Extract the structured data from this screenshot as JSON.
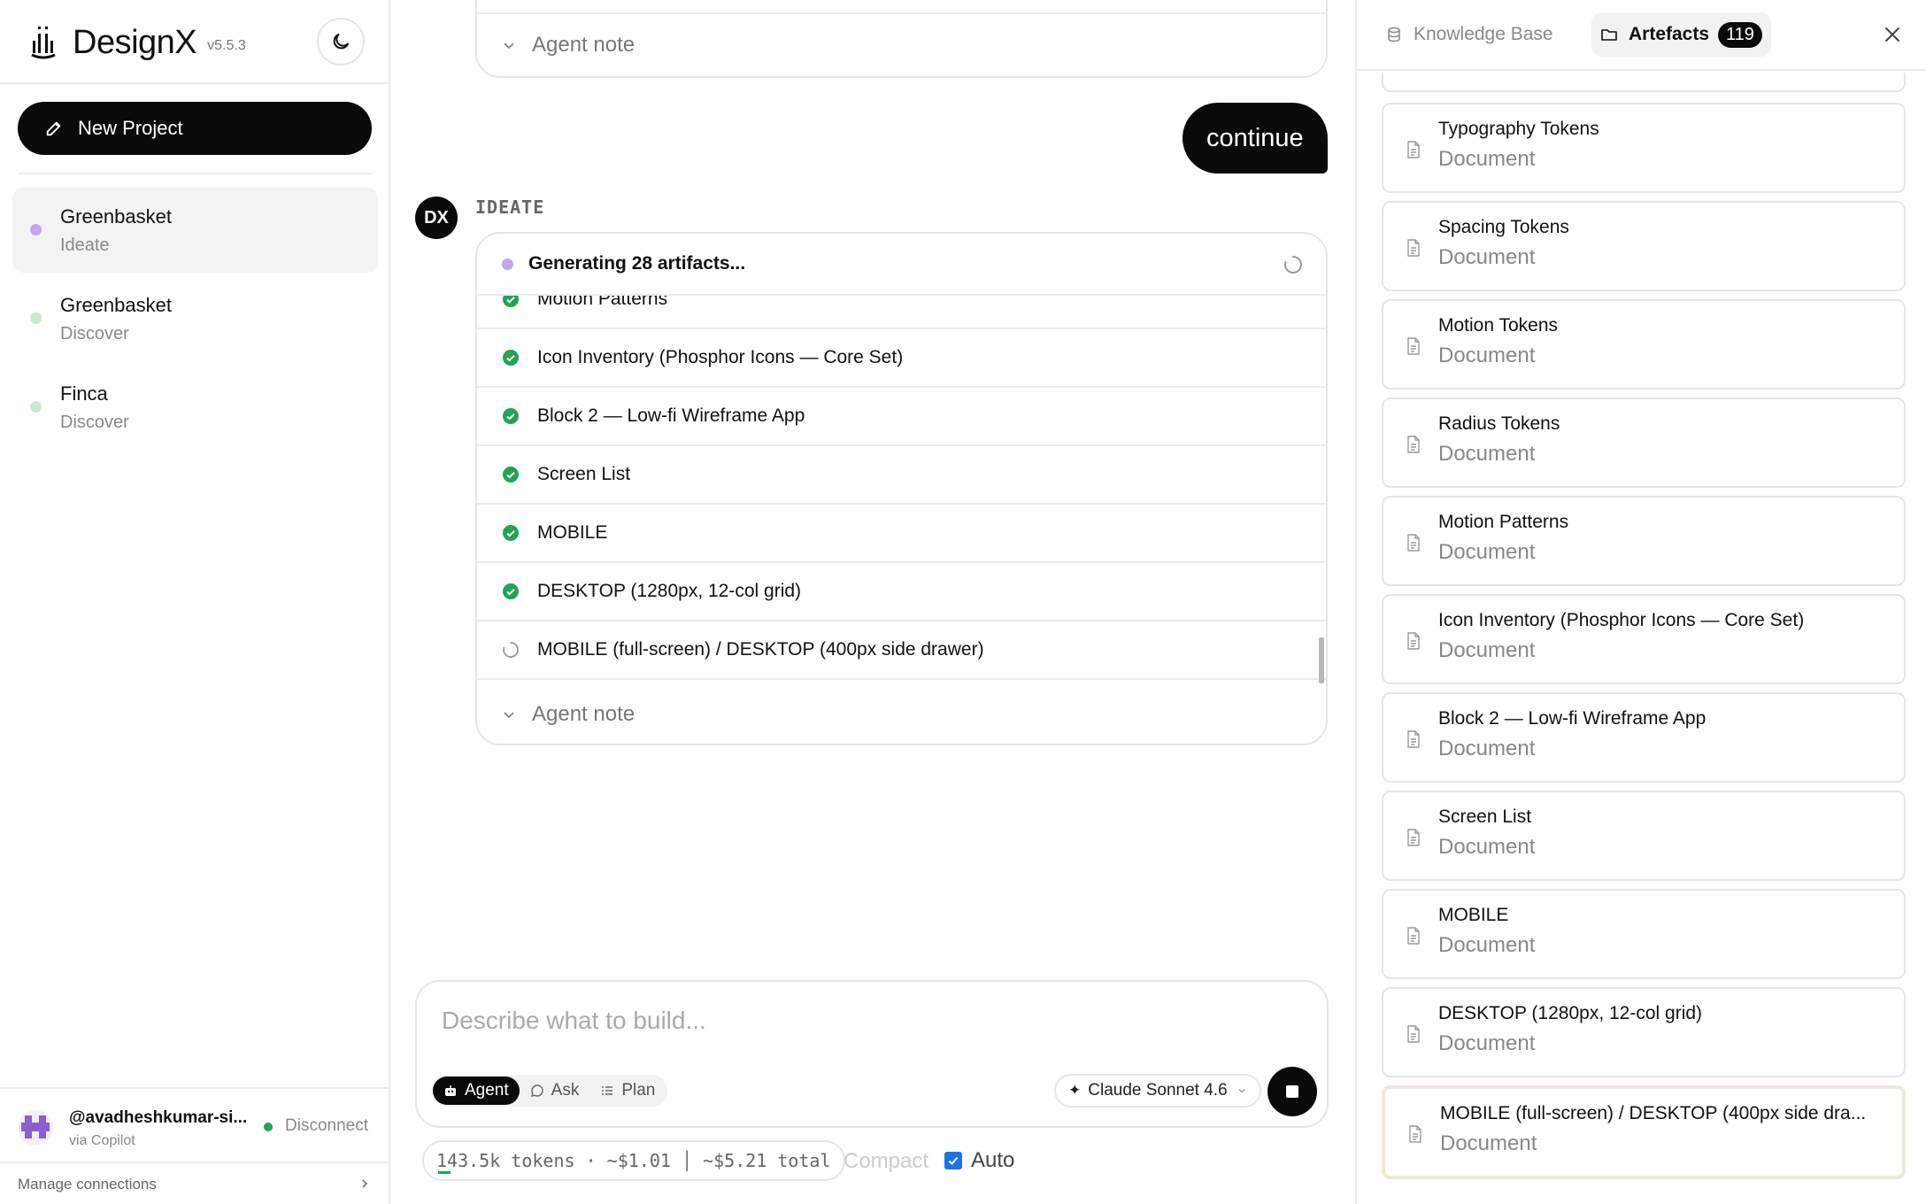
{
  "sidebar": {
    "brand": {
      "name": "DesignX",
      "version": "v5.5.3"
    },
    "new_project_label": "New Project",
    "projects": [
      {
        "name": "Greenbasket",
        "phase": "Ideate",
        "dot_color": "#c4a9ec",
        "active": true
      },
      {
        "name": "Greenbasket",
        "phase": "Discover",
        "dot_color": "#c9e8d2",
        "active": false
      },
      {
        "name": "Finca",
        "phase": "Discover",
        "dot_color": "#c9e8d2",
        "active": false
      }
    ],
    "user": {
      "handle": "@avadheshkumar-si...",
      "via": "via Copilot",
      "status_label": "Disconnect"
    },
    "manage_connections_label": "Manage connections"
  },
  "chat": {
    "top_card": {
      "agent_note_label": "Agent note"
    },
    "user_message": "continue",
    "agent": {
      "avatar": "DX",
      "phase_label": "IDEATE",
      "generating_label": "Generating 28 artifacts...",
      "items": [
        {
          "label": "Motion Patterns",
          "status": "done"
        },
        {
          "label": "Icon Inventory (Phosphor Icons — Core Set)",
          "status": "done"
        },
        {
          "label": "Block 2 — Low-fi Wireframe App",
          "status": "done"
        },
        {
          "label": "Screen List",
          "status": "done"
        },
        {
          "label": "MOBILE",
          "status": "done"
        },
        {
          "label": "DESKTOP (1280px, 12-col grid)",
          "status": "done"
        },
        {
          "label": "MOBILE (full-screen) / DESKTOP (400px side drawer)",
          "status": "in-progress"
        }
      ],
      "agent_note_label": "Agent note"
    },
    "composer": {
      "placeholder": "Describe what to build...",
      "modes": [
        {
          "label": "Agent",
          "icon": "robot-icon",
          "active": true
        },
        {
          "label": "Ask",
          "icon": "chat-bubble-icon",
          "active": false
        },
        {
          "label": "Plan",
          "icon": "list-icon",
          "active": false
        }
      ],
      "model_label": "Claude Sonnet 4.6",
      "model_icon": "sparkle-icon"
    },
    "usage": {
      "tokens_text": "143.5k tokens · ~$1.01 │ ~$5.21 total",
      "compact_label": "Compact",
      "auto_label": "Auto",
      "auto_checked": true
    }
  },
  "panel": {
    "tabs": [
      {
        "label": "Knowledge Base",
        "icon": "database-icon",
        "active": false
      },
      {
        "label": "Artefacts",
        "icon": "folder-icon",
        "active": true,
        "count": "119"
      }
    ],
    "documents": [
      {
        "name": "Typography Tokens",
        "type": "Document"
      },
      {
        "name": "Spacing Tokens",
        "type": "Document"
      },
      {
        "name": "Motion Tokens",
        "type": "Document"
      },
      {
        "name": "Radius Tokens",
        "type": "Document"
      },
      {
        "name": "Motion Patterns",
        "type": "Document"
      },
      {
        "name": "Icon Inventory (Phosphor Icons — Core Set)",
        "type": "Document"
      },
      {
        "name": "Block 2 — Low-fi Wireframe App",
        "type": "Document"
      },
      {
        "name": "Screen List",
        "type": "Document"
      },
      {
        "name": "MOBILE",
        "type": "Document"
      },
      {
        "name": "DESKTOP (1280px, 12-col grid)",
        "type": "Document"
      },
      {
        "name": "MOBILE (full-screen) / DESKTOP (400px side dra...",
        "type": "Document",
        "selected": true
      }
    ]
  },
  "colors": {
    "accent": "#0a0a0a",
    "success": "#22a355",
    "ideate_dot": "#c4a9ec",
    "discover_dot": "#c9e8d2",
    "checkbox": "#1a73e8"
  }
}
